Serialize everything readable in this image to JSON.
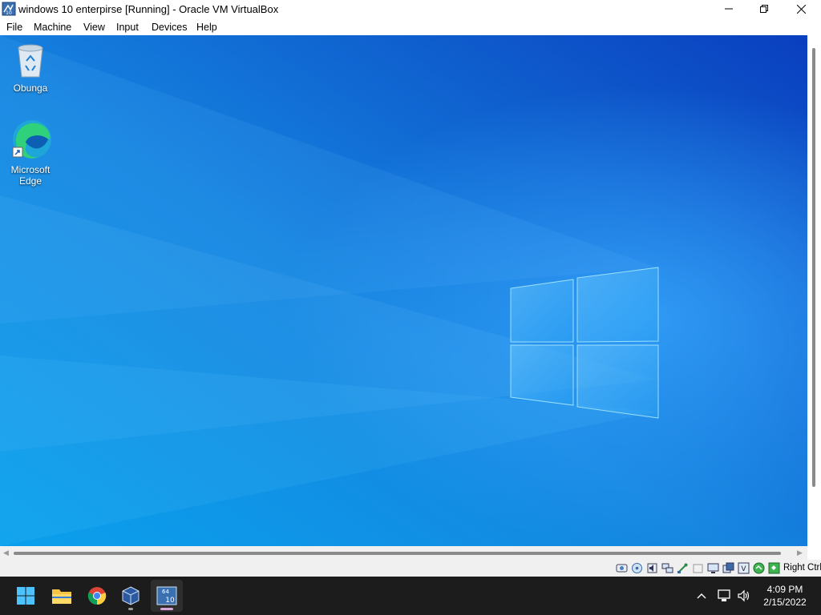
{
  "window": {
    "title": "windows 10 enterpirse [Running] - Oracle VM VirtualBox",
    "controls": {
      "minimize": "minimize",
      "maximize": "maximize",
      "close": "close"
    }
  },
  "menu": {
    "items": [
      "File",
      "Machine",
      "View",
      "Input",
      "Devices",
      "Help"
    ]
  },
  "guest_desktop": {
    "icons": [
      {
        "label": "Obunga",
        "icon": "recycle-bin-icon"
      },
      {
        "label": "Microsoft Edge",
        "icon": "edge-icon"
      }
    ],
    "wallpaper": "windows-10-light-logo"
  },
  "status_bar": {
    "icons": [
      "hard-disk-icon",
      "optical-drive-icon",
      "audio-icon",
      "network-icon",
      "usb-icon",
      "shared-folders-icon",
      "display-icon",
      "video-capture-icon",
      "cpu-icon",
      "mouse-integration-icon",
      "keyboard-icon"
    ],
    "host_key": "Right Ctrl"
  },
  "taskbar": {
    "apps": [
      "start-icon",
      "file-explorer-icon",
      "chrome-icon",
      "virtualbox-manager-icon",
      "virtualbox-vm-icon"
    ],
    "time": "4:09 PM",
    "date": "2/15/2022"
  },
  "colors": {
    "wallpaper_primary": "#1f86d8",
    "wallpaper_dark": "#0b45c2",
    "taskbar_bg": "#1c1c1c"
  }
}
